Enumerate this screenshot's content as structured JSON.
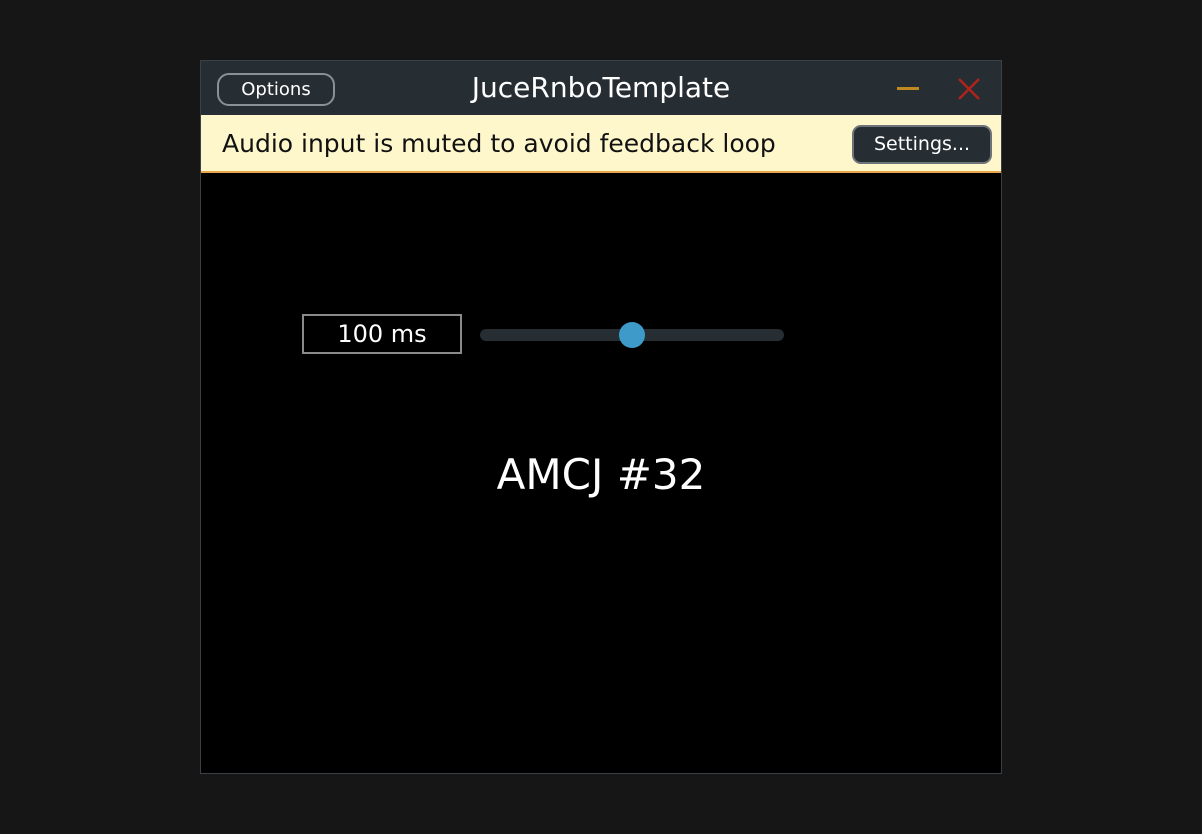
{
  "window": {
    "title": "JuceRnboTemplate",
    "options_label": "Options",
    "minimize_icon": "minimize-icon",
    "close_icon": "close-icon",
    "minimize_color": "#c18a1e",
    "close_color": "#b2221c"
  },
  "notice": {
    "text": "Audio input is muted to avoid feedback loop",
    "settings_label": "Settings...",
    "background": "#fdf7cb",
    "border_color": "#e8a64a"
  },
  "parameter": {
    "value_text": "100 ms",
    "slider_fraction": 0.5,
    "thumb_color": "#3d9ac9"
  },
  "main": {
    "label": "AMCJ #32"
  }
}
